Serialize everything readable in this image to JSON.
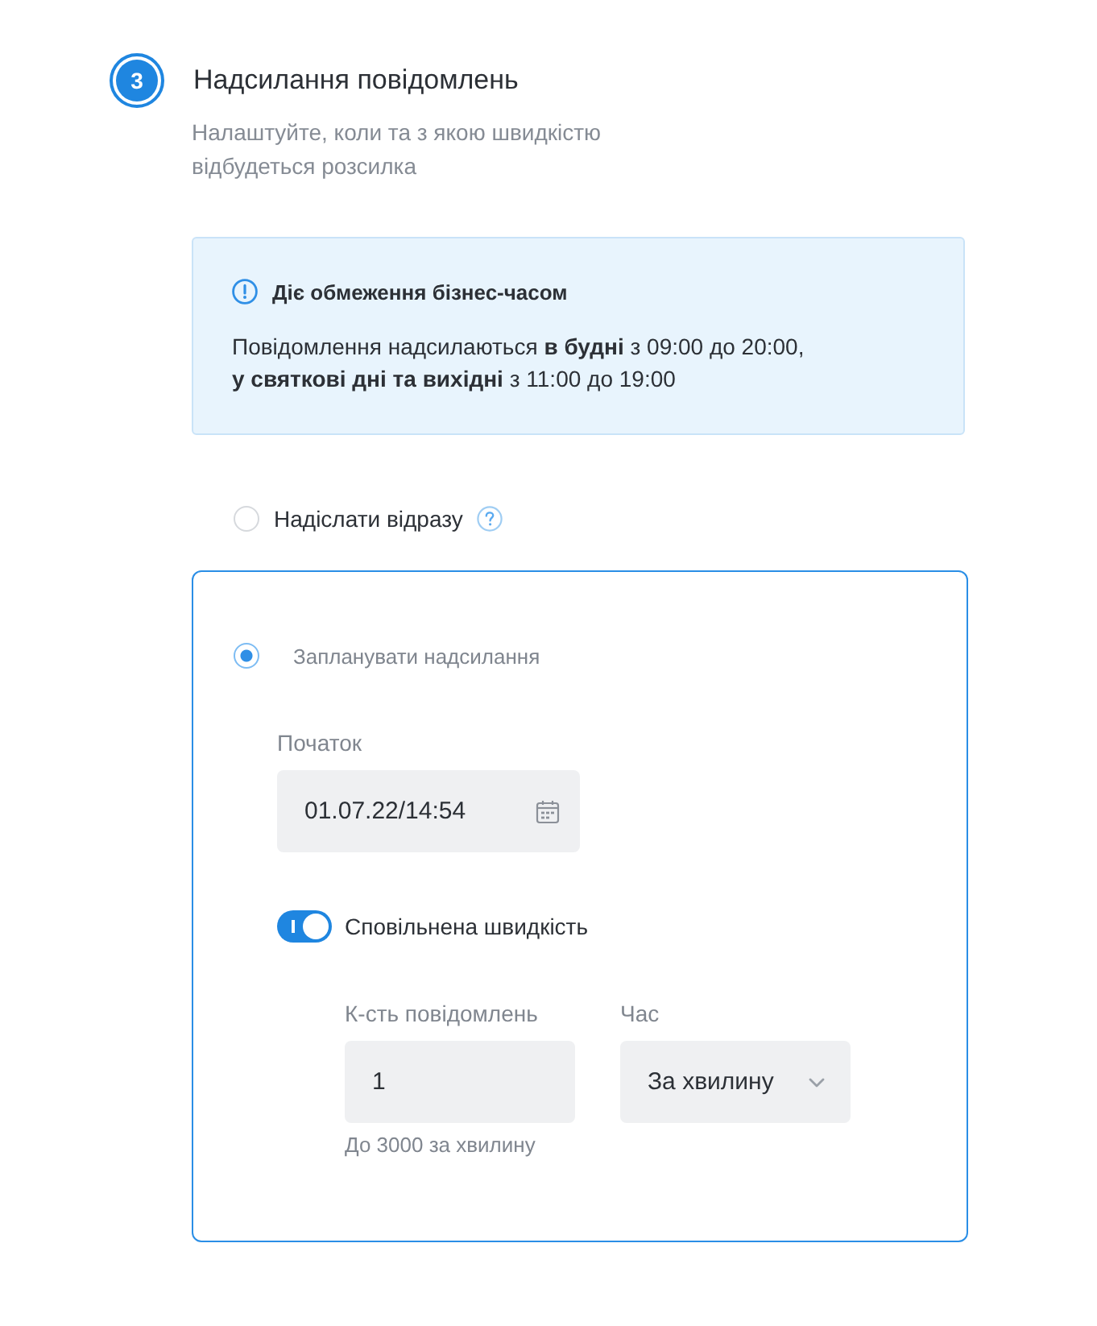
{
  "step": {
    "number": "3",
    "title": "Надсилання повідомлень",
    "description": "Налаштуйте, коли та з якою швидкістю відбудеться розсилка"
  },
  "notice": {
    "title": "Діє обмеження бізнес-часом",
    "text": "Повідомлення надсилаються **в будні** з 09:00 до 20:00,\n**у святкові дні та вихідні** з 11:00 до 19:00"
  },
  "send_options": [
    {
      "kind": "immediate",
      "label": "Надіслати відразу",
      "selected": false
    },
    {
      "kind": "scheduled",
      "label": "Запланувати надсилання",
      "selected": true,
      "settings": {
        "start": {
          "label": "Початок",
          "value": "01.07.22/14:54"
        },
        "slow_speed": {
          "label": "Сповільнена швидкість",
          "on": true
        },
        "count": {
          "label": "К-сть повідомлень",
          "value": "1",
          "hint": "До 3000 за хвилину"
        },
        "period": {
          "label": "Час",
          "value": "За хвилину"
        }
      }
    }
  ]
}
